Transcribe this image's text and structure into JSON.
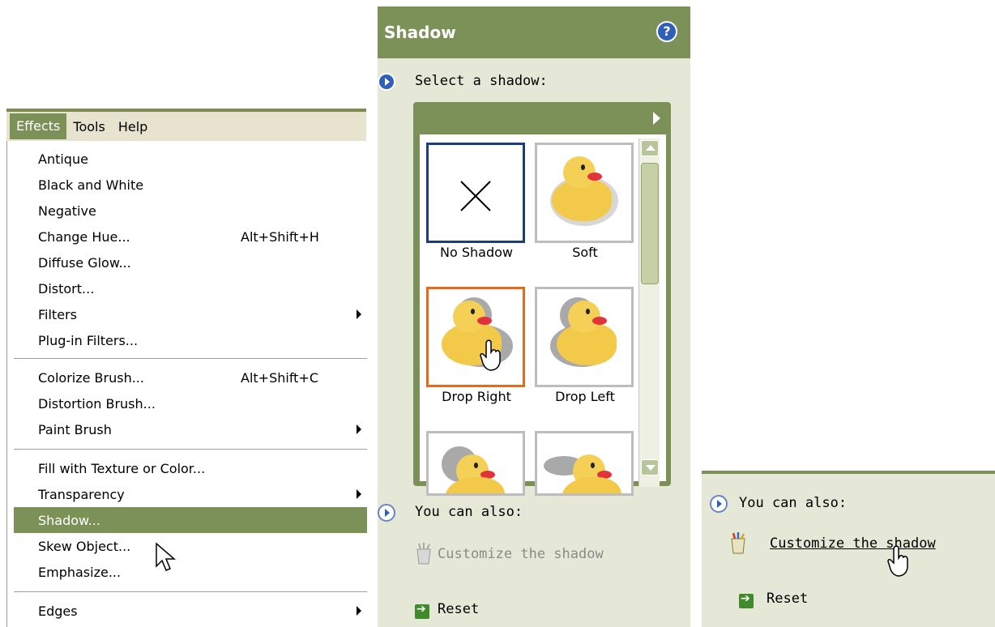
{
  "menu": {
    "menubar": [
      "Effects",
      "Tools",
      "Help"
    ],
    "items": [
      {
        "label": "Antique"
      },
      {
        "label": "Black and White"
      },
      {
        "label": "Negative"
      },
      {
        "label": "Change Hue...",
        "shortcut": "Alt+Shift+H"
      },
      {
        "label": "Diffuse Glow..."
      },
      {
        "label": "Distort..."
      },
      {
        "label": "Filters",
        "submenu": true
      },
      {
        "label": "Plug-in Filters..."
      },
      {
        "label": "Colorize Brush...",
        "shortcut": "Alt+Shift+C"
      },
      {
        "label": "Distortion Brush..."
      },
      {
        "label": "Paint Brush",
        "submenu": true
      },
      {
        "label": "Fill with Texture or Color..."
      },
      {
        "label": "Transparency",
        "submenu": true
      },
      {
        "label": "Shadow...",
        "highlighted": true
      },
      {
        "label": "Skew Object..."
      },
      {
        "label": "Emphasize..."
      },
      {
        "label": "Edges",
        "submenu": true
      }
    ]
  },
  "shadow_pane": {
    "title": "Shadow",
    "select_label": "Select a shadow:",
    "thumbnails": [
      {
        "caption": "No Shadow"
      },
      {
        "caption": "Soft"
      },
      {
        "caption": "Drop Right"
      },
      {
        "caption": "Drop Left"
      }
    ],
    "also_label": "You can also:",
    "customize_link": "Customize the shadow",
    "reset_label": "Reset"
  },
  "panel3": {
    "also_label": "You can also:",
    "customize_link": "Customize the shadow",
    "reset_label": "Reset"
  },
  "colors": {
    "accent": "#7c9158",
    "pane_bg": "#e5e8d6",
    "selected_blue": "#1d3d7c",
    "selected_orange": "#e76a1a"
  }
}
